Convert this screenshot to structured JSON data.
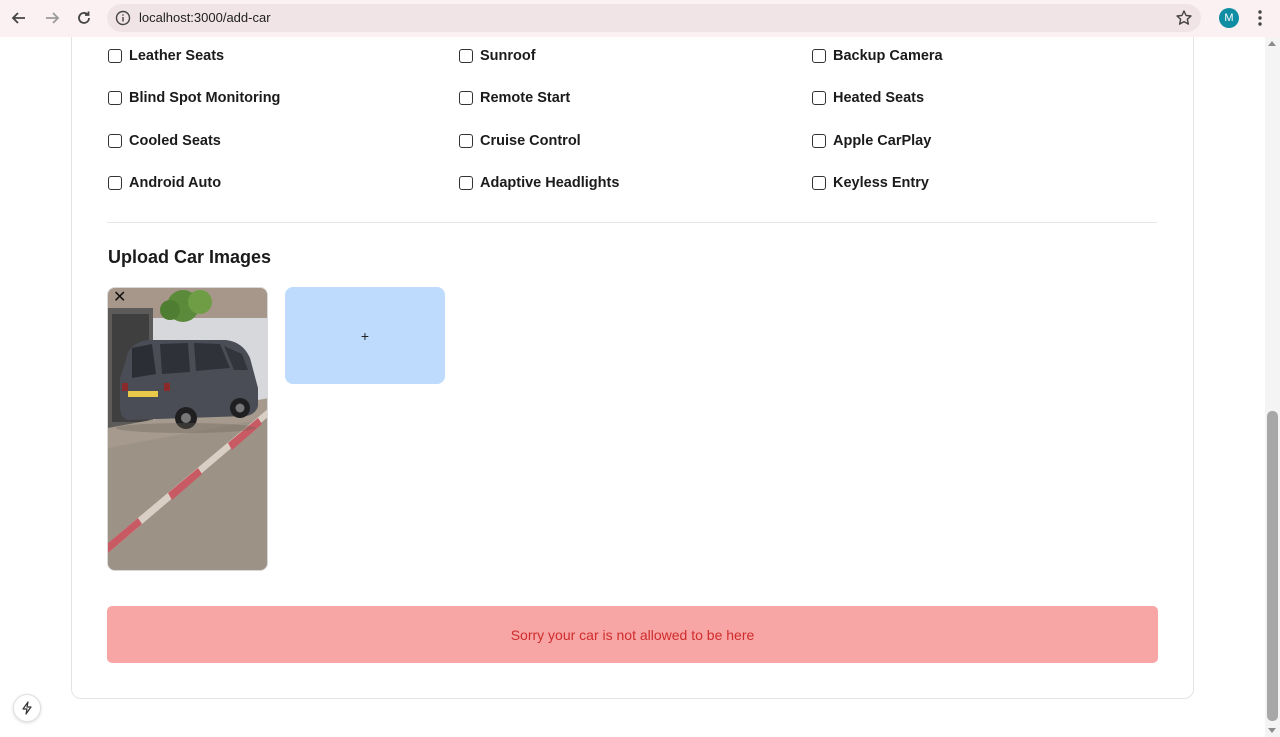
{
  "browser": {
    "url": "localhost:3000/add-car",
    "profile_initial": "M",
    "icons": [
      "back-arrow-icon",
      "forward-arrow-icon",
      "reload-icon",
      "info-icon",
      "star-icon",
      "kebab-menu-icon"
    ]
  },
  "features": {
    "col1": [
      "Leather Seats",
      "Blind Spot Monitoring",
      "Cooled Seats",
      "Android Auto"
    ],
    "col2": [
      "Sunroof",
      "Remote Start",
      "Cruise Control",
      "Adaptive Headlights"
    ],
    "col3": [
      "Backup Camera",
      "Heated Seats",
      "Apple CarPlay",
      "Keyless Entry"
    ]
  },
  "upload": {
    "title": "Upload Car Images",
    "remove_symbol": "✕",
    "add_symbol": "+"
  },
  "error": {
    "message": "Sorry your car is not allowed to be here"
  },
  "colors": {
    "add_tile": "#bedbfd",
    "error_bg": "#f8a5a5",
    "error_text": "#cf2c2c",
    "avatar": "#0f8ea3"
  }
}
